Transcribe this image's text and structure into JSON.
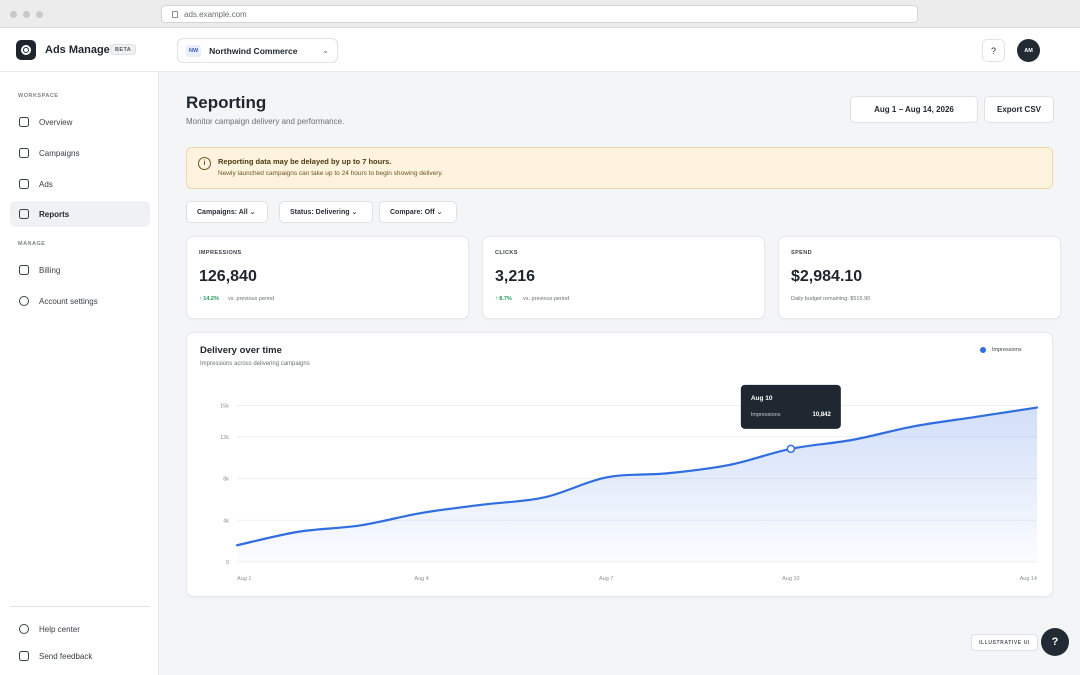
{
  "browser": {
    "url": "ads.example.com"
  },
  "app": {
    "name": "Ads Manager",
    "badge": "BETA"
  },
  "account": {
    "initials": "NW",
    "name": "Northwind Commerce",
    "chevron": "⌄"
  },
  "topbar": {
    "help": "?",
    "avatar": "AM"
  },
  "sidebar": {
    "workspace_label": "WORKSPACE",
    "items": [
      {
        "label": "Overview",
        "icon": "square-icon"
      },
      {
        "label": "Campaigns",
        "icon": "square-icon"
      },
      {
        "label": "Ads",
        "icon": "square-icon"
      },
      {
        "label": "Reports",
        "icon": "square-icon",
        "active": true
      }
    ],
    "manage_label": "MANAGE",
    "manage_items": [
      {
        "label": "Billing",
        "icon": "square-icon"
      },
      {
        "label": "Account settings",
        "icon": "circle-icon"
      }
    ],
    "footer_items": [
      {
        "label": "Help center",
        "icon": "circle-icon"
      },
      {
        "label": "Send feedback",
        "icon": "square-icon"
      }
    ]
  },
  "page": {
    "title": "Reporting",
    "subtitle": "Monitor campaign delivery and performance.",
    "date_range": "Aug 1 – Aug 14, 2026",
    "export_label": "Export CSV"
  },
  "alert": {
    "icon": "i",
    "title": "Reporting data may be delayed by up to 7 hours.",
    "body": "Newly launched campaigns can take up to 24 hours to begin showing delivery."
  },
  "filters": [
    "Campaigns: All ⌄",
    "Status: Delivering ⌄",
    "Compare: Off ⌄"
  ],
  "stats": [
    {
      "label": "IMPRESSIONS",
      "value": "126,840",
      "delta": "↑ 14.2%",
      "note": "vs. previous period"
    },
    {
      "label": "CLICKS",
      "value": "3,216",
      "delta": "↑ 8.7%",
      "note": "vs. previous period"
    },
    {
      "label": "SPEND",
      "value": "$2,984.10",
      "delta": "",
      "note": "Daily budget remaining: $515.90"
    }
  ],
  "chart": {
    "title": "Delivery over time",
    "subtitle": "Impressions across delivering campaigns",
    "legend": "Impressions",
    "tooltip": {
      "date": "Aug 10",
      "label": "Impressions",
      "value": "10,842"
    },
    "accent": "#2f6de1"
  },
  "chart_data": {
    "type": "area",
    "x_tick_labels": [
      "Aug 1",
      "Aug 4",
      "Aug 7",
      "Aug 10",
      "Aug 14"
    ],
    "y_tick_labels": [
      "0",
      "4k",
      "8k",
      "12k",
      "15k"
    ],
    "ylim": [
      0,
      16000
    ],
    "series": [
      {
        "name": "Impressions",
        "x": [
          "Aug 1",
          "Aug 2",
          "Aug 3",
          "Aug 4",
          "Aug 5",
          "Aug 6",
          "Aug 7",
          "Aug 8",
          "Aug 9",
          "Aug 10",
          "Aug 11",
          "Aug 12",
          "Aug 13",
          "Aug 14"
        ],
        "values": [
          1600,
          2900,
          3500,
          4700,
          5500,
          6200,
          8100,
          8500,
          9300,
          10842,
          11700,
          13000,
          13900,
          14800
        ]
      }
    ],
    "highlight_index": 9,
    "grid": true
  },
  "footer": {
    "illustrative": "ILLUSTRATIVE UI",
    "fab": "?"
  }
}
